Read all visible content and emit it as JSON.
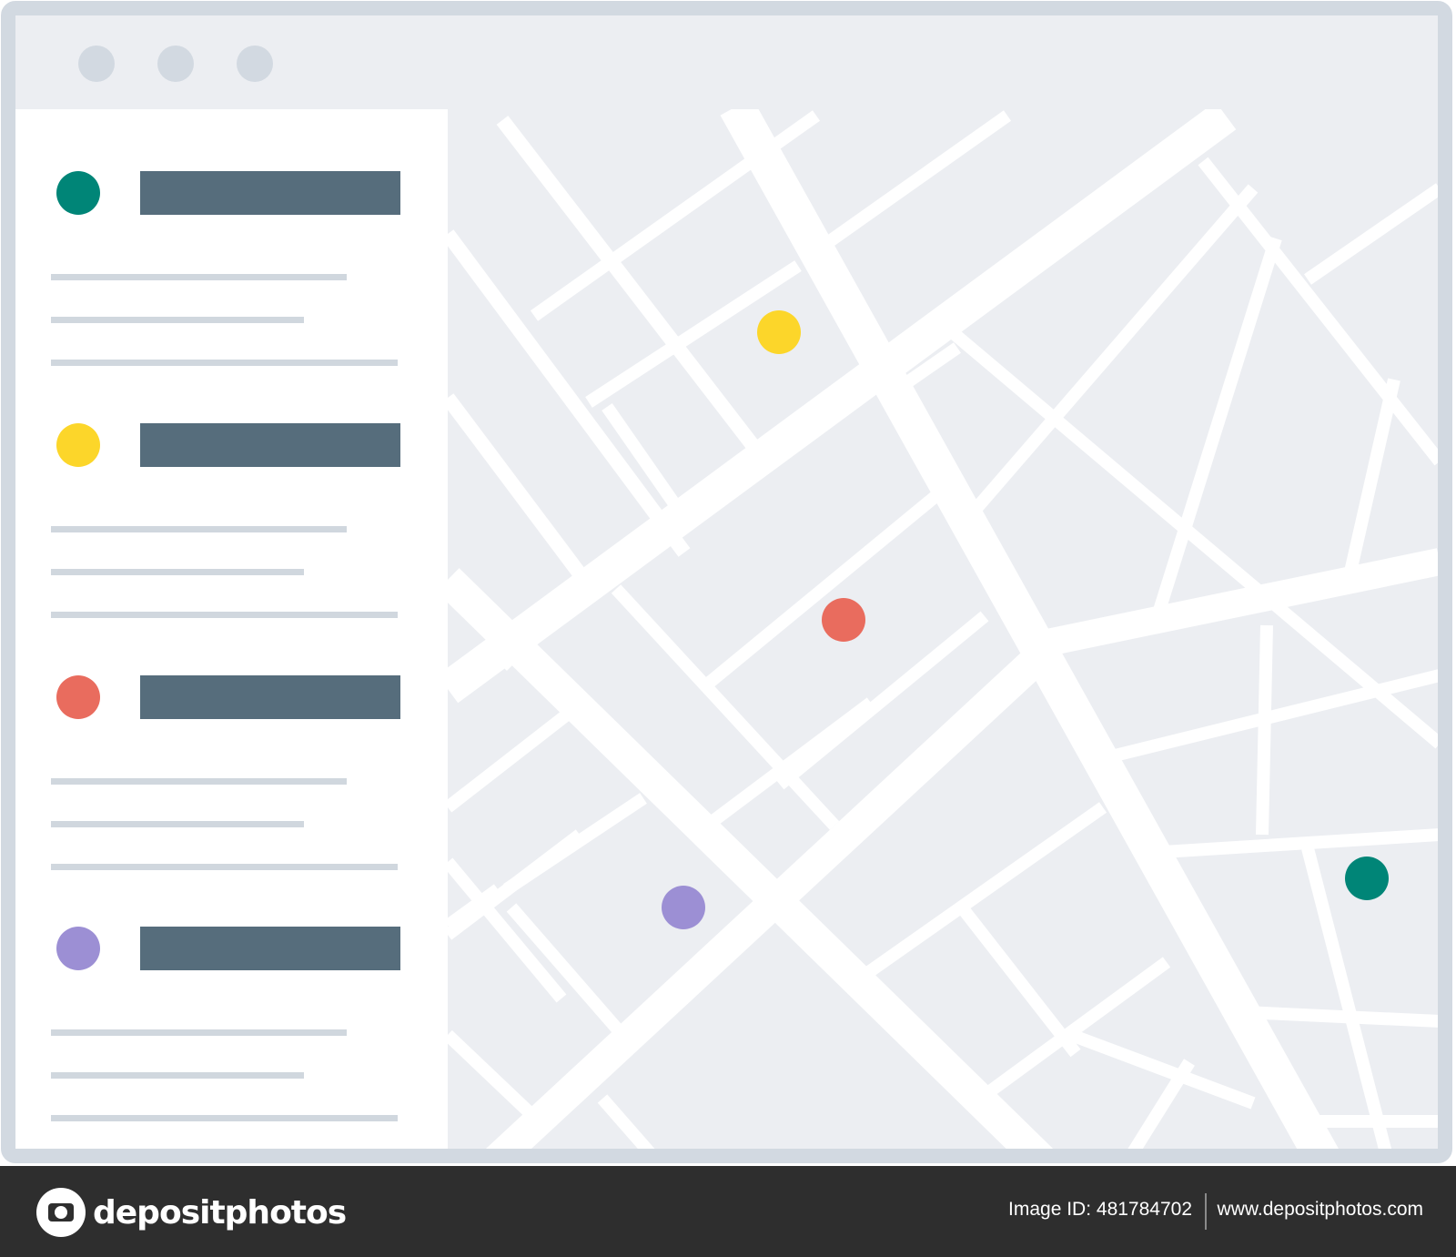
{
  "colors": {
    "frame": "#d2d9e1",
    "background": "#eceef2",
    "panel": "#ffffff",
    "title_bar": "#566d7c",
    "text_line": "#d0d7de",
    "road": "#ffffff",
    "footer": "#2e2e2e"
  },
  "window_controls": [
    {
      "name": "window-control-1"
    },
    {
      "name": "window-control-2"
    },
    {
      "name": "window-control-3"
    }
  ],
  "sidebar": {
    "items": [
      {
        "pin_color": "#008577"
      },
      {
        "pin_color": "#fcd62a"
      },
      {
        "pin_color": "#e96c5e"
      },
      {
        "pin_color": "#9c8fd4"
      }
    ]
  },
  "map": {
    "pins": [
      {
        "color": "#fcd62a"
      },
      {
        "color": "#e96c5e"
      },
      {
        "color": "#9c8fd4"
      },
      {
        "color": "#008577"
      }
    ]
  },
  "footer": {
    "brand": "depositphotos",
    "image_id": "Image ID: 481784702",
    "site_url": "www.depositphotos.com"
  }
}
